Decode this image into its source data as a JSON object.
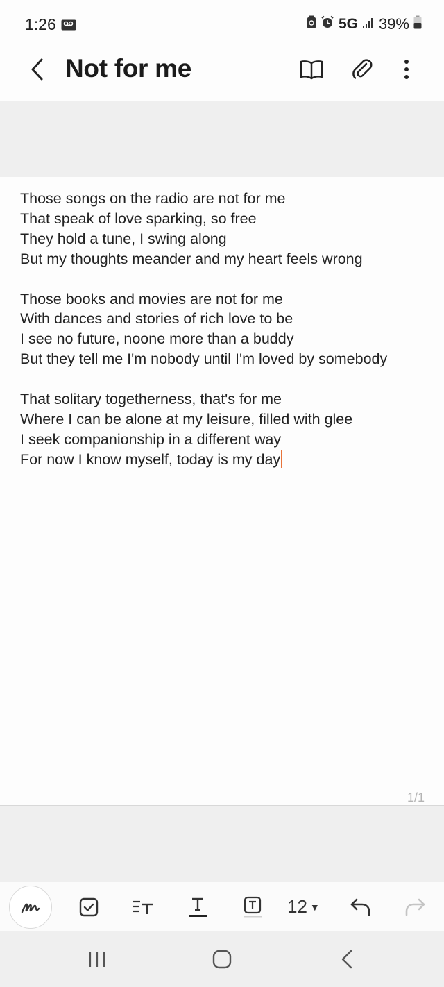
{
  "status_bar": {
    "time": "1:26",
    "network": "5G",
    "battery": "39%",
    "icons": [
      "voicemail-icon",
      "battery-saver-icon",
      "alarm-icon",
      "signal-icon",
      "battery-icon"
    ]
  },
  "app_bar": {
    "title": "Not for me",
    "icons": [
      "back-icon",
      "reading-mode-icon",
      "attach-icon",
      "more-icon"
    ]
  },
  "note": {
    "stanzas": [
      [
        "Those songs on the radio are not for me",
        "That speak of love sparking, so free",
        "They hold a tune, I swing along",
        "But my thoughts meander and my heart feels wrong"
      ],
      [
        "Those books and movies are not for me",
        "With dances and stories of rich love to be",
        "I see no future, noone more than a buddy",
        "But they tell me I'm nobody until I'm loved by somebody"
      ],
      [
        "That solitary togetherness, that's for me",
        "Where I can be alone at my leisure, filled with glee",
        "I seek companionship in a different way",
        "For now I know myself, today is my day"
      ]
    ],
    "page_indicator": "1/1",
    "cursor_color": "#e8743b"
  },
  "toolbar": {
    "font_size": "12",
    "icons": [
      "pen-icon",
      "checkbox-icon",
      "text-style-icon",
      "text-color-icon",
      "text-box-icon",
      "undo-icon",
      "redo-icon"
    ]
  },
  "nav_bar": {
    "icons": [
      "recents-icon",
      "home-icon",
      "back-nav-icon"
    ]
  }
}
